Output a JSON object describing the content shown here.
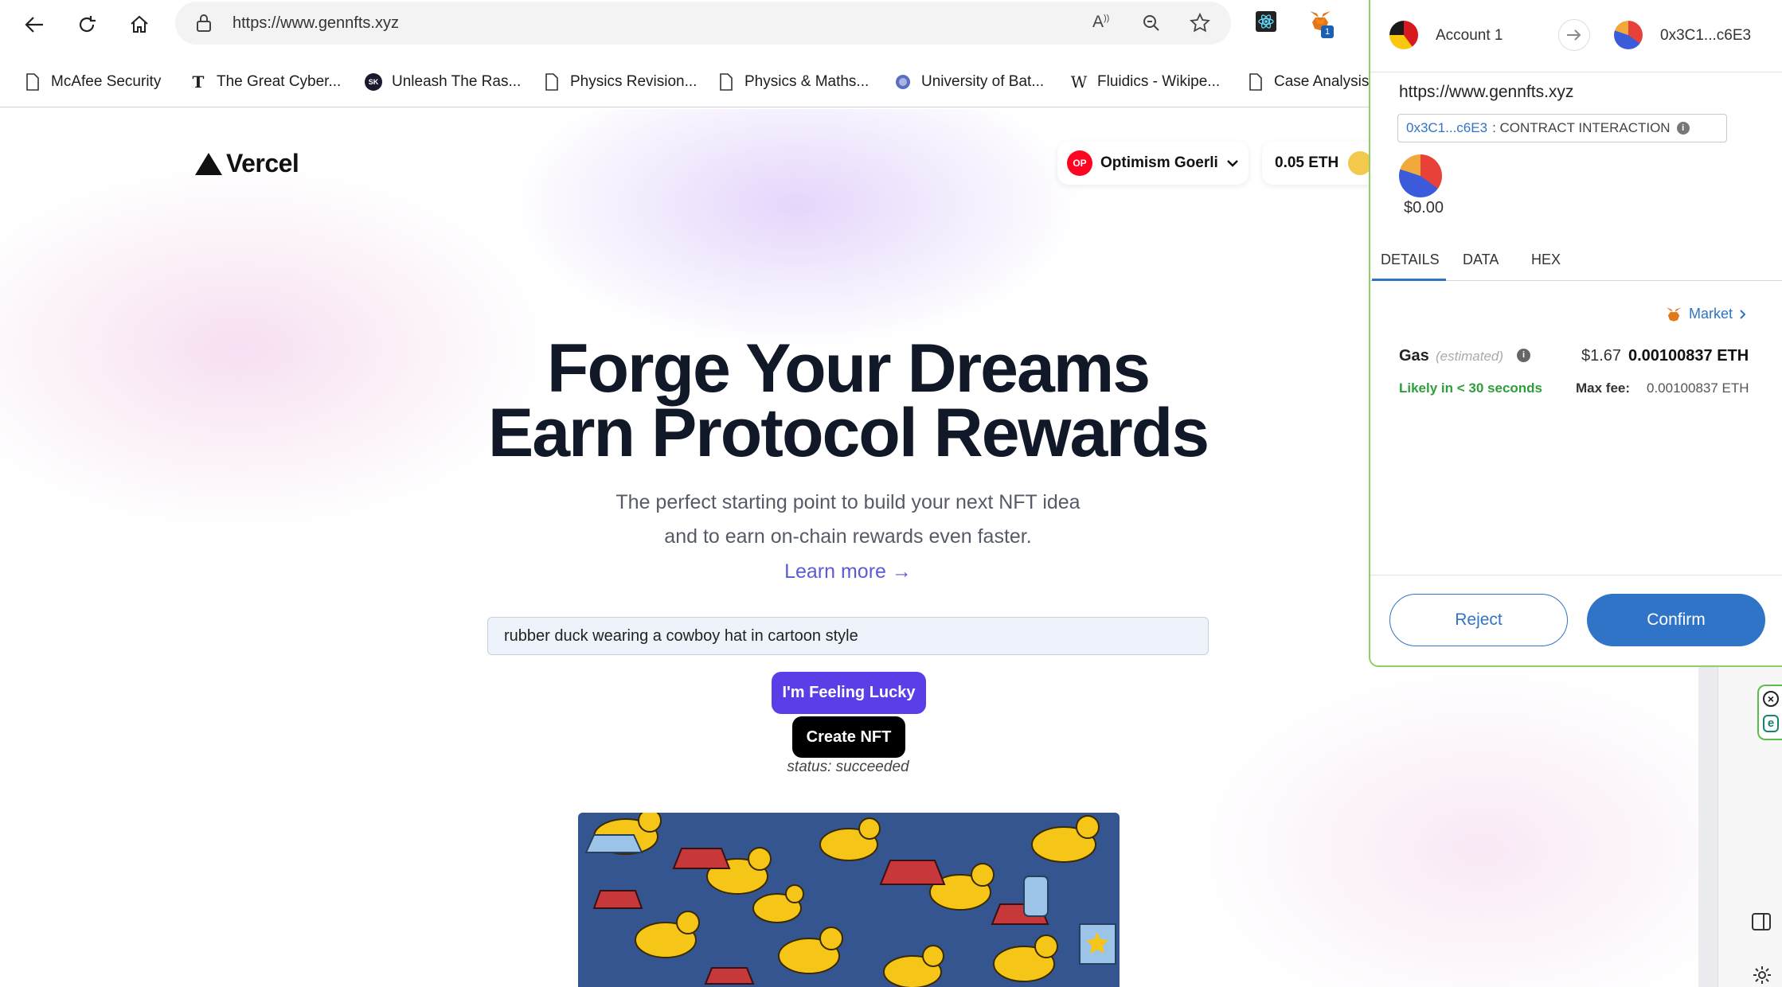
{
  "browser": {
    "url": "https://www.gennfts.xyz",
    "extension_badge_count": "1",
    "bookmarks": [
      {
        "label": "McAfee Security",
        "icon": "document-icon"
      },
      {
        "label": "The Great Cyber...",
        "icon": "nyt-icon"
      },
      {
        "label": "Unleash The Ras...",
        "icon": "sk-icon"
      },
      {
        "label": "Physics Revision...",
        "icon": "document-icon"
      },
      {
        "label": "Physics & Maths...",
        "icon": "document-icon"
      },
      {
        "label": "University of Bat...",
        "icon": "globe-icon"
      },
      {
        "label": "Fluidics - Wikipe...",
        "icon": "wikipedia-icon"
      },
      {
        "label": "Case Analysis o",
        "icon": "document-icon"
      }
    ]
  },
  "site": {
    "logo_text": "Vercel",
    "network": {
      "badge": "OP",
      "label": "Optimism Goerli"
    },
    "balance": "0.05 ETH",
    "hero_line1": "Forge Your Dreams",
    "hero_line2": "Earn Protocol Rewards",
    "subtitle_line1": "The perfect starting point to build your next NFT idea",
    "subtitle_line2": "and to earn on-chain rewards even faster.",
    "learn_more": "Learn more →",
    "prompt_value": "rubber duck wearing a cowboy hat in cartoon style",
    "lucky_button": "I'm Feeling Lucky",
    "create_button": "Create NFT",
    "status": "status: succeeded"
  },
  "metamask": {
    "account_name": "Account 1",
    "recipient": "0x3C1...c6E3",
    "origin": "https://www.gennfts.xyz",
    "contract_address": "0x3C1...c6E3",
    "contract_label": ": CONTRACT INTERACTION",
    "amount": "$0.00",
    "tabs": [
      "DETAILS",
      "DATA",
      "HEX"
    ],
    "market_label": "Market",
    "gas_label": "Gas",
    "gas_estimated": "(estimated)",
    "gas_usd": "$1.67",
    "gas_eth": "0.00100837 ETH",
    "likely": "Likely in < 30 seconds",
    "max_fee_label": "Max fee:",
    "max_fee_value": "0.00100837 ETH",
    "reject": "Reject",
    "confirm": "Confirm"
  },
  "colors": {
    "accent_blue": "#2f74c6",
    "lucky_purple": "#5b3ee8",
    "likely_green": "#2e9e3c",
    "link_purple": "#5b5bd6"
  }
}
